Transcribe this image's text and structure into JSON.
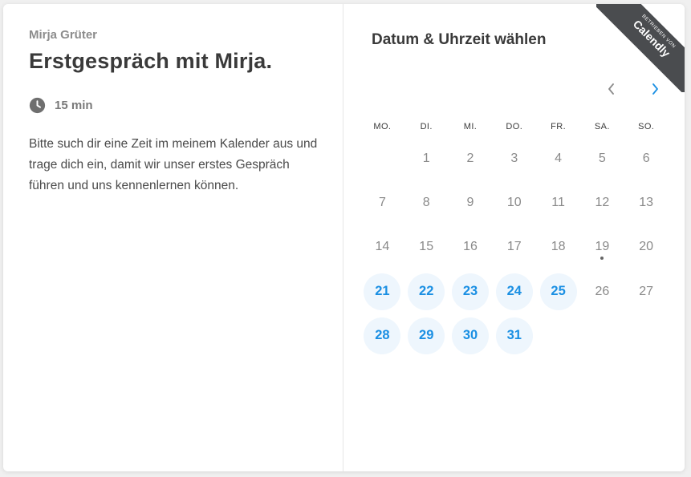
{
  "event": {
    "organizer": "Mirja Grüter",
    "title": "Erstgespräch mit Mirja.",
    "duration": "15 min",
    "description": "Bitte such dir eine Zeit im meinem Kalender aus und trage dich ein, damit wir unser erstes Gespräch führen und uns kennenlernen können."
  },
  "calendar": {
    "heading": "Datum & Uhrzeit wählen",
    "weekdays": [
      "MO.",
      "DI.",
      "MI.",
      "DO.",
      "FR.",
      "SA.",
      "SO."
    ],
    "first_weekday_offset": 1,
    "days": [
      {
        "d": "1",
        "available": false
      },
      {
        "d": "2",
        "available": false
      },
      {
        "d": "3",
        "available": false
      },
      {
        "d": "4",
        "available": false
      },
      {
        "d": "5",
        "available": false
      },
      {
        "d": "6",
        "available": false
      },
      {
        "d": "7",
        "available": false
      },
      {
        "d": "8",
        "available": false
      },
      {
        "d": "9",
        "available": false
      },
      {
        "d": "10",
        "available": false
      },
      {
        "d": "11",
        "available": false
      },
      {
        "d": "12",
        "available": false
      },
      {
        "d": "13",
        "available": false
      },
      {
        "d": "14",
        "available": false
      },
      {
        "d": "15",
        "available": false
      },
      {
        "d": "16",
        "available": false
      },
      {
        "d": "17",
        "available": false
      },
      {
        "d": "18",
        "available": false
      },
      {
        "d": "19",
        "available": false,
        "today": true
      },
      {
        "d": "20",
        "available": false
      },
      {
        "d": "21",
        "available": true
      },
      {
        "d": "22",
        "available": true
      },
      {
        "d": "23",
        "available": true
      },
      {
        "d": "24",
        "available": true
      },
      {
        "d": "25",
        "available": true
      },
      {
        "d": "26",
        "available": false
      },
      {
        "d": "27",
        "available": false
      },
      {
        "d": "28",
        "available": true
      },
      {
        "d": "29",
        "available": true
      },
      {
        "d": "30",
        "available": true
      },
      {
        "d": "31",
        "available": true
      }
    ]
  },
  "badge": {
    "small": "BETRIEBEN VON",
    "brand": "Calendly"
  },
  "icons": {
    "duration": "clock-icon",
    "prev": "chevron-left-icon",
    "next": "chevron-right-icon"
  },
  "colors": {
    "accent": "#1a8fe3",
    "available_bg": "#eef6fd",
    "ribbon": "#4a4c4f"
  }
}
